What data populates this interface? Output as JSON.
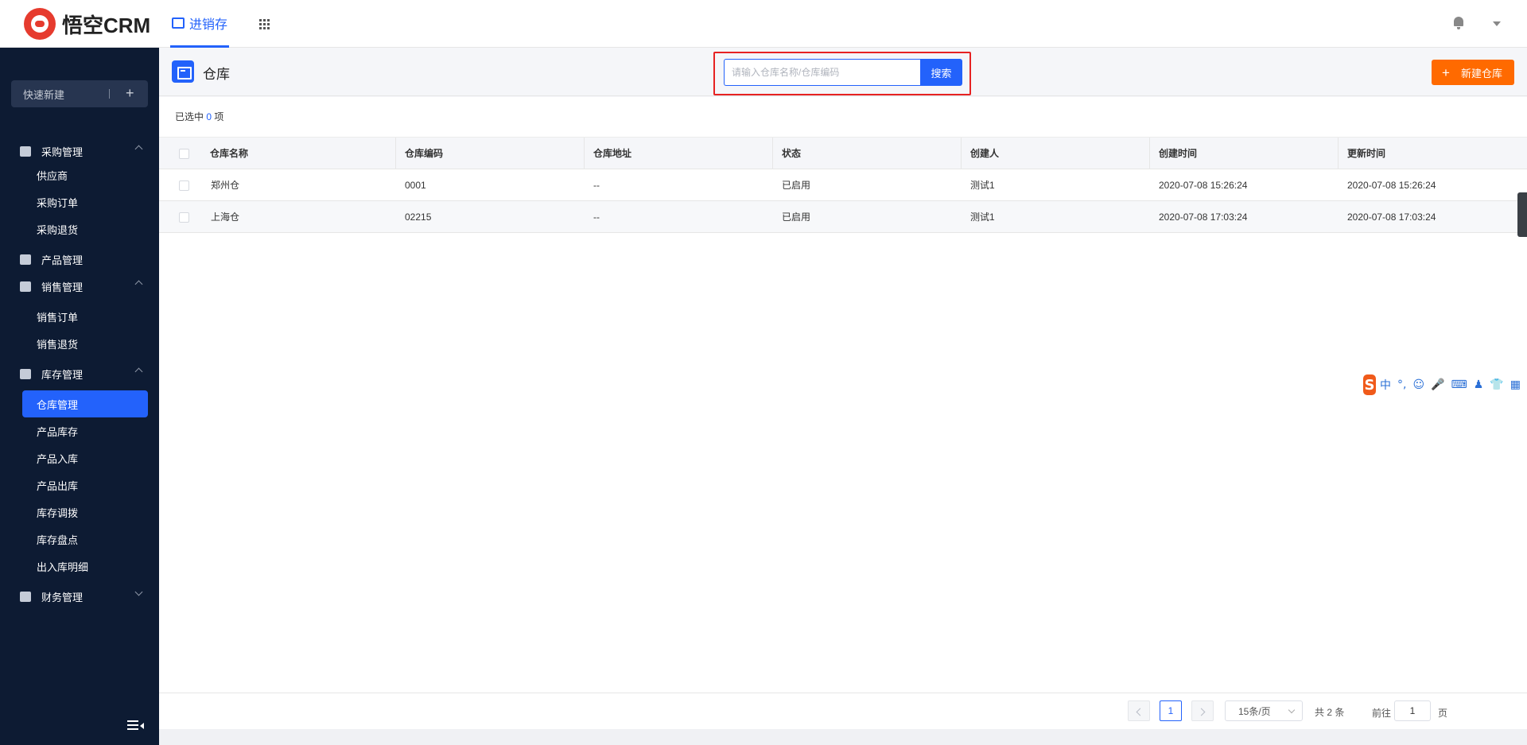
{
  "app": {
    "logo_text": "悟空CRM",
    "nav_tab": "进销存"
  },
  "sidebar": {
    "quick_new": "快速新建",
    "groups": {
      "purchase": "采购管理",
      "product": "产品管理",
      "sales": "销售管理",
      "inventory": "库存管理",
      "finance": "财务管理"
    },
    "items": {
      "supplier": "供应商",
      "purchase_order": "采购订单",
      "purchase_return": "采购退货",
      "sales_order": "销售订单",
      "sales_return": "销售退货",
      "warehouse_mgmt": "仓库管理",
      "product_stock": "产品库存",
      "product_in": "产品入库",
      "product_out": "产品出库",
      "stock_transfer": "库存调拨",
      "stock_check": "库存盘点",
      "in_out_detail": "出入库明细"
    }
  },
  "header": {
    "title": "仓库",
    "search_placeholder": "请输入仓库名称/仓库编码",
    "search_button": "搜索",
    "new_button": "新建仓库"
  },
  "selection": {
    "prefix": "已选中",
    "count": "0",
    "suffix": "项"
  },
  "table": {
    "columns": [
      "仓库名称",
      "仓库编码",
      "仓库地址",
      "状态",
      "创建人",
      "创建时间",
      "更新时间"
    ],
    "rows": [
      [
        "郑州仓",
        "0001",
        "--",
        "已启用",
        "测试1",
        "2020-07-08 15:26:24",
        "2020-07-08 15:26:24"
      ],
      [
        "上海仓",
        "02215",
        "--",
        "已启用",
        "测试1",
        "2020-07-08 17:03:24",
        "2020-07-08 17:03:24"
      ]
    ]
  },
  "pagination": {
    "current_page": "1",
    "page_size": "15条/页",
    "total": "共 2 条",
    "goto_label": "前往",
    "goto_value": "1",
    "page_suffix": "页"
  },
  "ime": {
    "items": [
      "中",
      "°,",
      "☺",
      "🎤",
      "⌨",
      "♟",
      "👕",
      "▦"
    ]
  },
  "colors": {
    "accent": "#2362fb",
    "orange": "#ff6a00",
    "sidebar_bg": "#0d1b33",
    "highlight": "#e62222"
  }
}
